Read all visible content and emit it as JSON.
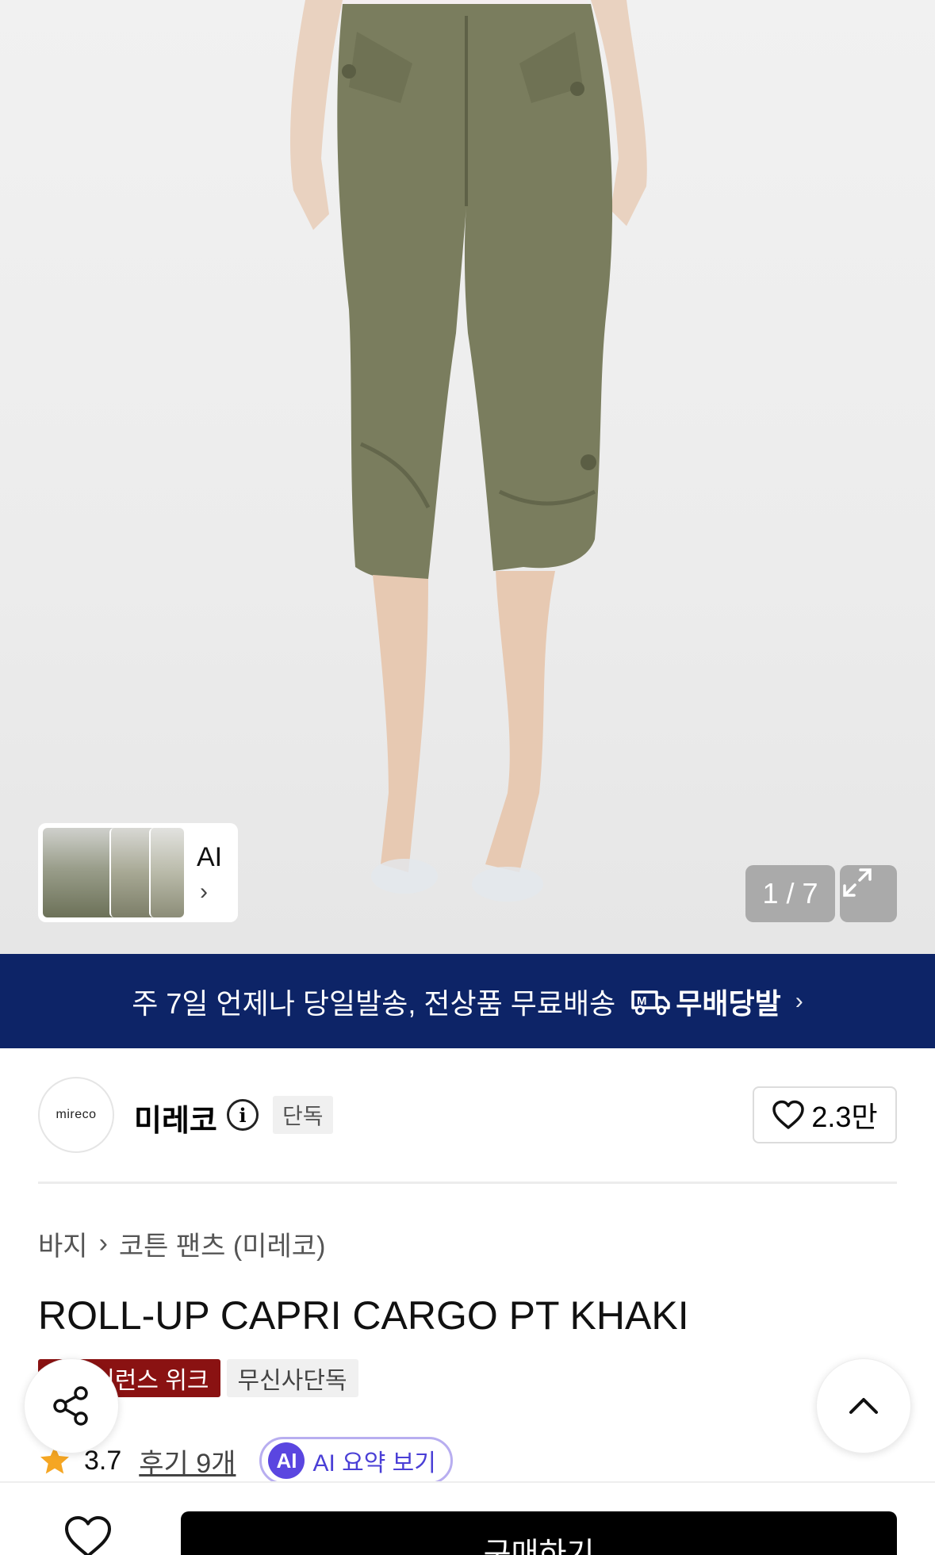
{
  "gallery": {
    "thumb_label": "AI",
    "thumb_chevron": "›",
    "counter": "1 / 7",
    "expand_icon": "expand-icon"
  },
  "banner": {
    "text": "주 7일 언제나 당일발송, 전상품 무료배송",
    "badge_label": "무배당발",
    "chevron": "›",
    "color": "#0d2467"
  },
  "brand": {
    "logo_text": "mireco",
    "name": "미레코",
    "exclusive_tag": "단독",
    "like_count": "2.3만"
  },
  "product": {
    "breadcrumb": [
      "바지",
      "코튼 팬츠 (미레코)"
    ],
    "breadcrumb_separator": "›",
    "title": "ROLL-UP CAPRI CARGO PT KHAKI",
    "tags": [
      "클리어런스 위크",
      "무신사단독"
    ],
    "rating": "3.7",
    "review_link": "후기 9개",
    "ai_badge": "AI",
    "ai_summary_label": "AI 요약 보기"
  },
  "actions": {
    "buy_label": "구매하기",
    "accent_red": "#8a1212",
    "star_color": "#f5a623",
    "ai_color": "#5a46e0"
  }
}
